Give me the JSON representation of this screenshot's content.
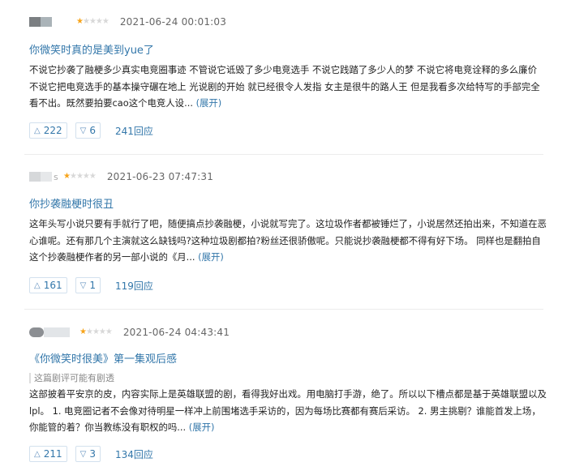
{
  "reviews": [
    {
      "username": "",
      "rating": 1,
      "time": "2021-06-24 00:01:03",
      "title": "你微笑时真的是美到yue了",
      "note": "",
      "body": "不说它抄袭了融梗多少真实电竞圈事迹 不管说它诋毁了多少电竞选手 不说它践踏了多少人的梦 不说它将电竞诠释的多么廉价 不说它把电竞选手的基本操守碾在地上 光说剧的开始 就已经很令人发指 女主是很牛的路人王 但是我看多次给特写的手部完全看不出。既然要拍要cao这个电竞人设...",
      "expand": "(展开)",
      "up": "222",
      "down": "6",
      "replies": "241回应"
    },
    {
      "username": "s",
      "rating": 1,
      "time": "2021-06-23 07:47:31",
      "title": "你抄袭融梗时很丑",
      "note": "",
      "body": "这年头写小说只要有手就行了吧，随便搞点抄袭融梗，小说就写完了。这垃圾作者都被锤烂了，小说居然还拍出来，不知道在恶心谁呢。还有那几个主演就这么缺钱吗?这种垃圾剧都拍?粉丝还很骄傲呢。只能说抄袭融梗都不得有好下场。 同样也是翻拍自这个抄袭融梗作者的另一部小说的《月...",
      "expand": "(展开)",
      "up": "161",
      "down": "1",
      "replies": "119回应"
    },
    {
      "username": "",
      "rating": 1,
      "time": "2021-06-24 04:43:41",
      "title": "《你微笑时很美》第一集观后感",
      "note": "这篇剧评可能有剧透",
      "body": "这部披着平安京的皮，内容实际上是英雄联盟的剧，看得我好出戏。用电脑打手游，绝了。所以以下槽点都是基于英雄联盟以及lpl。 1. 电竞圈记者不会像对待明星一样冲上前围堵选手采访的，因为每场比赛都有赛后采访。 2. 男主挑剔？谁能首发上场，你能管的着？你当教练没有职权的吗...",
      "expand": "(展开)",
      "up": "211",
      "down": "3",
      "replies": "134回应"
    }
  ],
  "icons": {
    "up_vote": "triangle-up-icon",
    "down_vote": "triangle-down-icon",
    "star": "star-icon"
  },
  "colors": {
    "link": "#3377aa",
    "star_on": "#f7a41a",
    "star_off": "#d8d8d8"
  }
}
